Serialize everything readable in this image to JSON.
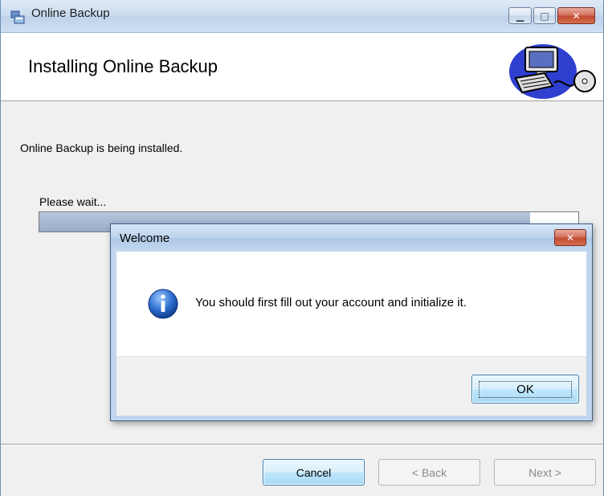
{
  "main_window": {
    "title": "Online Backup",
    "header_title": "Installing Online Backup",
    "status_text": "Online Backup is being installed.",
    "wait_label": "Please wait...",
    "progress_fraction": 0.91,
    "buttons": {
      "cancel": "Cancel",
      "back": "< Back",
      "next": "Next >"
    },
    "caption_buttons": {
      "minimize_icon": "minimize-icon",
      "maximize_icon": "maximize-icon",
      "close_icon": "close-icon"
    }
  },
  "dialog": {
    "title": "Welcome",
    "message": "You should first fill out your account and initialize it.",
    "icon": "info-icon",
    "ok_label": "OK"
  },
  "colors": {
    "accent": "#3c7fb1",
    "close_red": "#c24a32",
    "info_blue": "#1f5fbf"
  }
}
